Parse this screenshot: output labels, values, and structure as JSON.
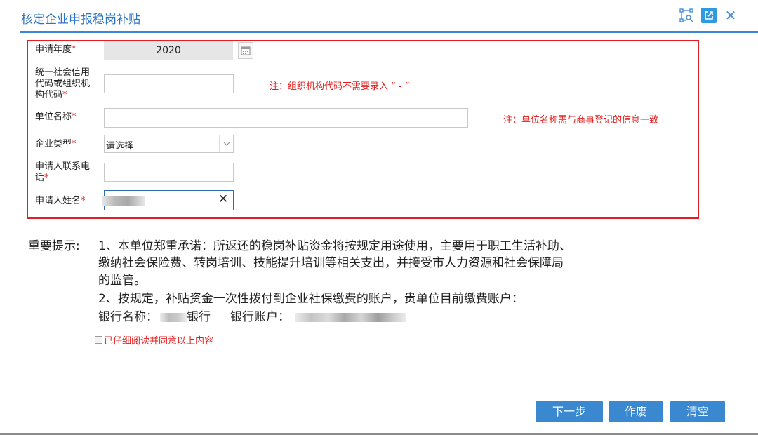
{
  "dialog": {
    "title": "核定企业申报稳岗补贴",
    "icons": [
      "scan-select-icon",
      "popout-icon",
      "close-icon"
    ]
  },
  "form": {
    "year": {
      "label": "申请年度",
      "required": "*",
      "value": "2020"
    },
    "credit_code": {
      "label_line1": "统一社会信用",
      "label_line2": "代码或组织机",
      "label_line3": "构代码",
      "required": "*",
      "value": "",
      "note": "注：组织机构代码不需要录入 “ - ”"
    },
    "unit_name": {
      "label": "单位名称",
      "required": "*",
      "value": "",
      "note": "注：单位名称需与商事登记的信息一致"
    },
    "enterprise_type": {
      "label": "企业类型",
      "required": "*",
      "selected": "请选择"
    },
    "phone": {
      "label_line1": "申请人联系电",
      "label_line2": "话",
      "required": "*",
      "value": ""
    },
    "applicant_name": {
      "label": "申请人姓名",
      "required": "*",
      "clear": "✕"
    }
  },
  "notice": {
    "heading": "重要提示:",
    "line1": "1、本单位郑重承诺：所返还的稳岗补贴资金将按规定用途使用，主要用于职工生活补助、",
    "line2": "缴纳社会保险费、转岗培训、技能提升培训等相关支出，并接受市人力资源和社会保障局",
    "line3": "的监管。",
    "line4": "2、按规定，补贴资金一次性拨付到企业社保缴费的账户，贵单位目前缴费账户：",
    "bank_name_label": "银行名称：",
    "bank_suffix": "银行",
    "bank_account_label": "银行账户："
  },
  "agree": {
    "label": "已仔细阅读并同意以上内容"
  },
  "buttons": {
    "next": "下一步",
    "void": "作废",
    "clear": "清空"
  },
  "colors": {
    "accent": "#3a89d0",
    "title": "#2c74c4",
    "required": "#e02020"
  }
}
